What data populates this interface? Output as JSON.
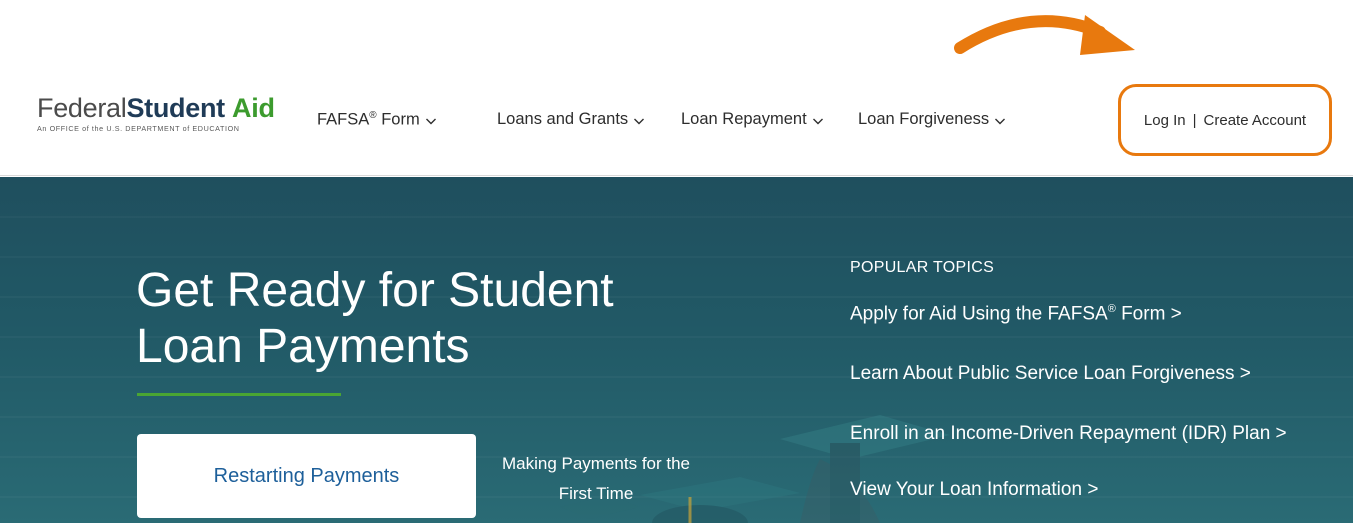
{
  "logo": {
    "word_federal": "Federal",
    "word_student": "Student",
    "word_aid": "Aid",
    "tagline": "An OFFICE of the U.S. DEPARTMENT of EDUCATION"
  },
  "nav": {
    "items": [
      {
        "label": "FAFSA",
        "sup": "®",
        "suffix": " Form"
      },
      {
        "label": "Loans and Grants"
      },
      {
        "label": "Loan Repayment"
      },
      {
        "label": "Loan Forgiveness"
      }
    ]
  },
  "account": {
    "login_label": "Log In",
    "separator": "|",
    "create_label": "Create Account"
  },
  "hero": {
    "title_line1": "Get Ready for Student",
    "title_line2": "Loan Payments",
    "primary_button": "Restarting Payments",
    "secondary_line1": "Making Payments for the",
    "secondary_line2": "First Time"
  },
  "popular": {
    "heading": "POPULAR TOPICS",
    "links": [
      {
        "label": "Apply for Aid Using the FAFSA",
        "sup": "®",
        "suffix": " Form >"
      },
      {
        "label": "Learn About Public Service Loan Forgiveness >"
      },
      {
        "label": "Enroll in an Income-Driven Repayment (IDR) Plan >"
      },
      {
        "label": "View Your Loan Information >"
      }
    ]
  },
  "colors": {
    "accent_orange": "#e8790e",
    "hero_bg": "#215966",
    "underline_green": "#4aa533",
    "link_blue": "#1d5f9a"
  }
}
